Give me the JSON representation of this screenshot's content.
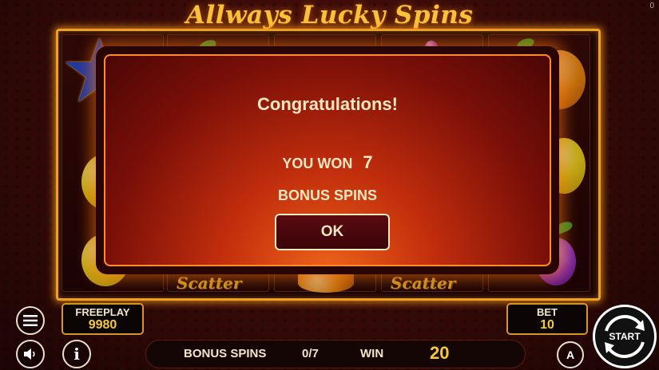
{
  "game": {
    "title": "Allways Lucky Spins",
    "corner_counter": "0"
  },
  "reels": {
    "scatter_label": "Scatter",
    "symbols": [
      "scatter-star",
      "lemon",
      "orange",
      "grape"
    ]
  },
  "dialog": {
    "heading": "Congratulations!",
    "won_prefix": "YOU WON",
    "won_count": "7",
    "won_suffix": "BONUS SPINS",
    "ok_label": "OK"
  },
  "freeplay": {
    "label": "FREEPLAY",
    "value": "9980"
  },
  "bet": {
    "label": "BET",
    "value": "10"
  },
  "status_bar": {
    "bonus_spins_label": "BONUS SPINS",
    "bonus_spins_value": "0/7",
    "win_label": "WIN",
    "win_value": "20"
  },
  "buttons": {
    "start_label": "START",
    "autoplay_letter": "A",
    "info_letter": "i"
  },
  "icons": [
    "menu-icon",
    "sound-icon",
    "info-icon",
    "autoplay-icon",
    "start-arrows-icon"
  ],
  "colors": {
    "accent_gold": "#f6c93a",
    "frame_orange": "#f0a020",
    "dialog_text": "#f4e7c2"
  }
}
